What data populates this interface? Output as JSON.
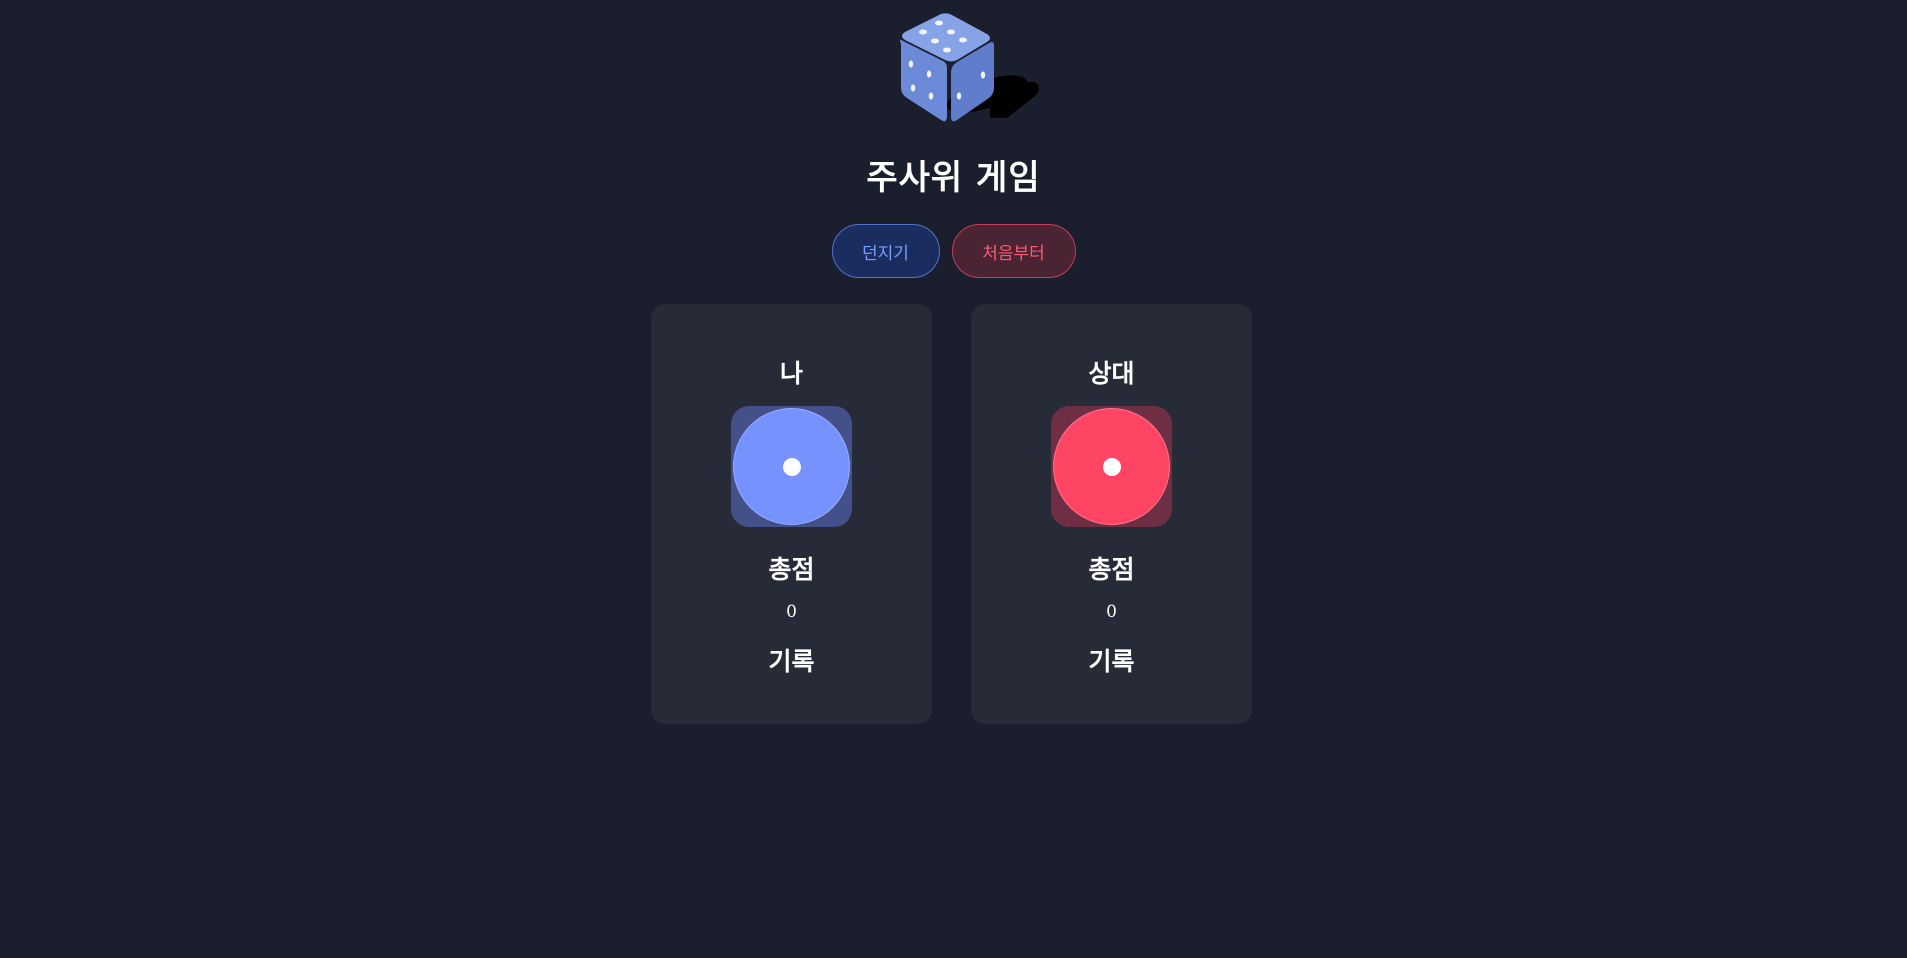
{
  "app": {
    "title": "주사위 게임",
    "logo_icon": "dice-icon"
  },
  "controls": {
    "roll_label": "던지기",
    "reset_label": "처음부터"
  },
  "players": [
    {
      "name": "나",
      "die_value": 1,
      "total_label": "총점",
      "total": "0",
      "history_label": "기록",
      "color": "#7592ff"
    },
    {
      "name": "상대",
      "die_value": 1,
      "total_label": "총점",
      "total": "0",
      "history_label": "기록",
      "color": "#ff4563"
    }
  ]
}
